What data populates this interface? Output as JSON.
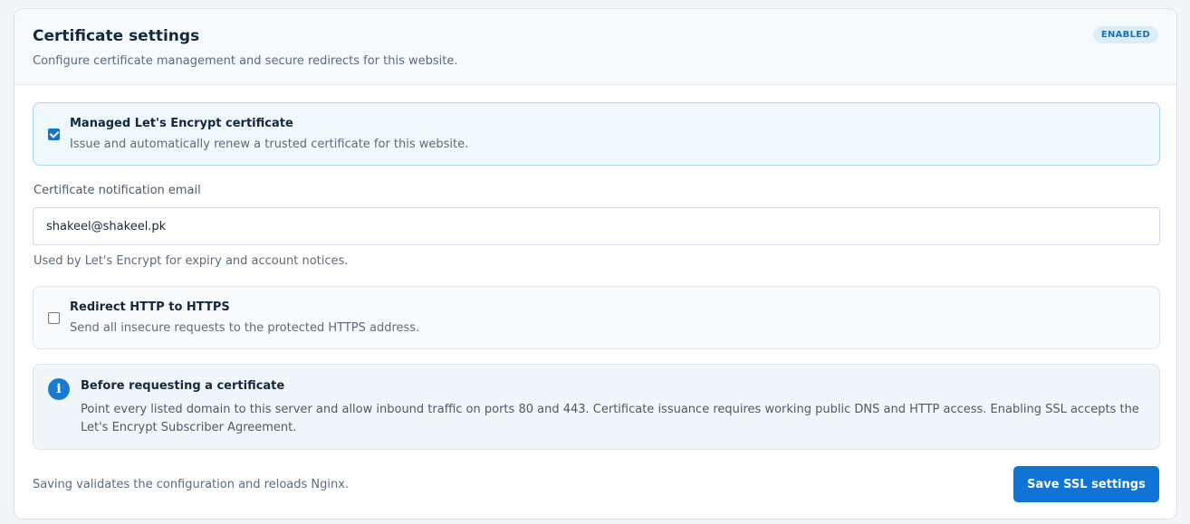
{
  "header": {
    "title": "Certificate settings",
    "subtitle": "Configure certificate management and secure redirects for this website.",
    "status_badge": "ENABLED"
  },
  "managed_certificate": {
    "label": "Managed Let's Encrypt certificate",
    "description": "Issue and automatically renew a trusted certificate for this website.",
    "checked": true
  },
  "email_field": {
    "label": "Certificate notification email",
    "value": "shakeel@shakeel.pk",
    "help": "Used by Let's Encrypt for expiry and account notices."
  },
  "redirect_https": {
    "label": "Redirect HTTP to HTTPS",
    "description": "Send all insecure requests to the protected HTTPS address.",
    "checked": false
  },
  "info_notice": {
    "icon": "info-icon",
    "icon_glyph": "i",
    "title": "Before requesting a certificate",
    "body": "Point every listed domain to this server and allow inbound traffic on ports 80 and 443. Certificate issuance requires working public DNS and HTTP access. Enabling SSL accepts the Let's Encrypt Subscriber Agreement."
  },
  "footer": {
    "note": "Saving validates the configuration and reloads Nginx.",
    "save_label": "Save SSL settings"
  },
  "colors": {
    "accent": "#0f74d6",
    "badge_bg": "#dcedfa",
    "active_option_bg": "#eef8fd"
  }
}
